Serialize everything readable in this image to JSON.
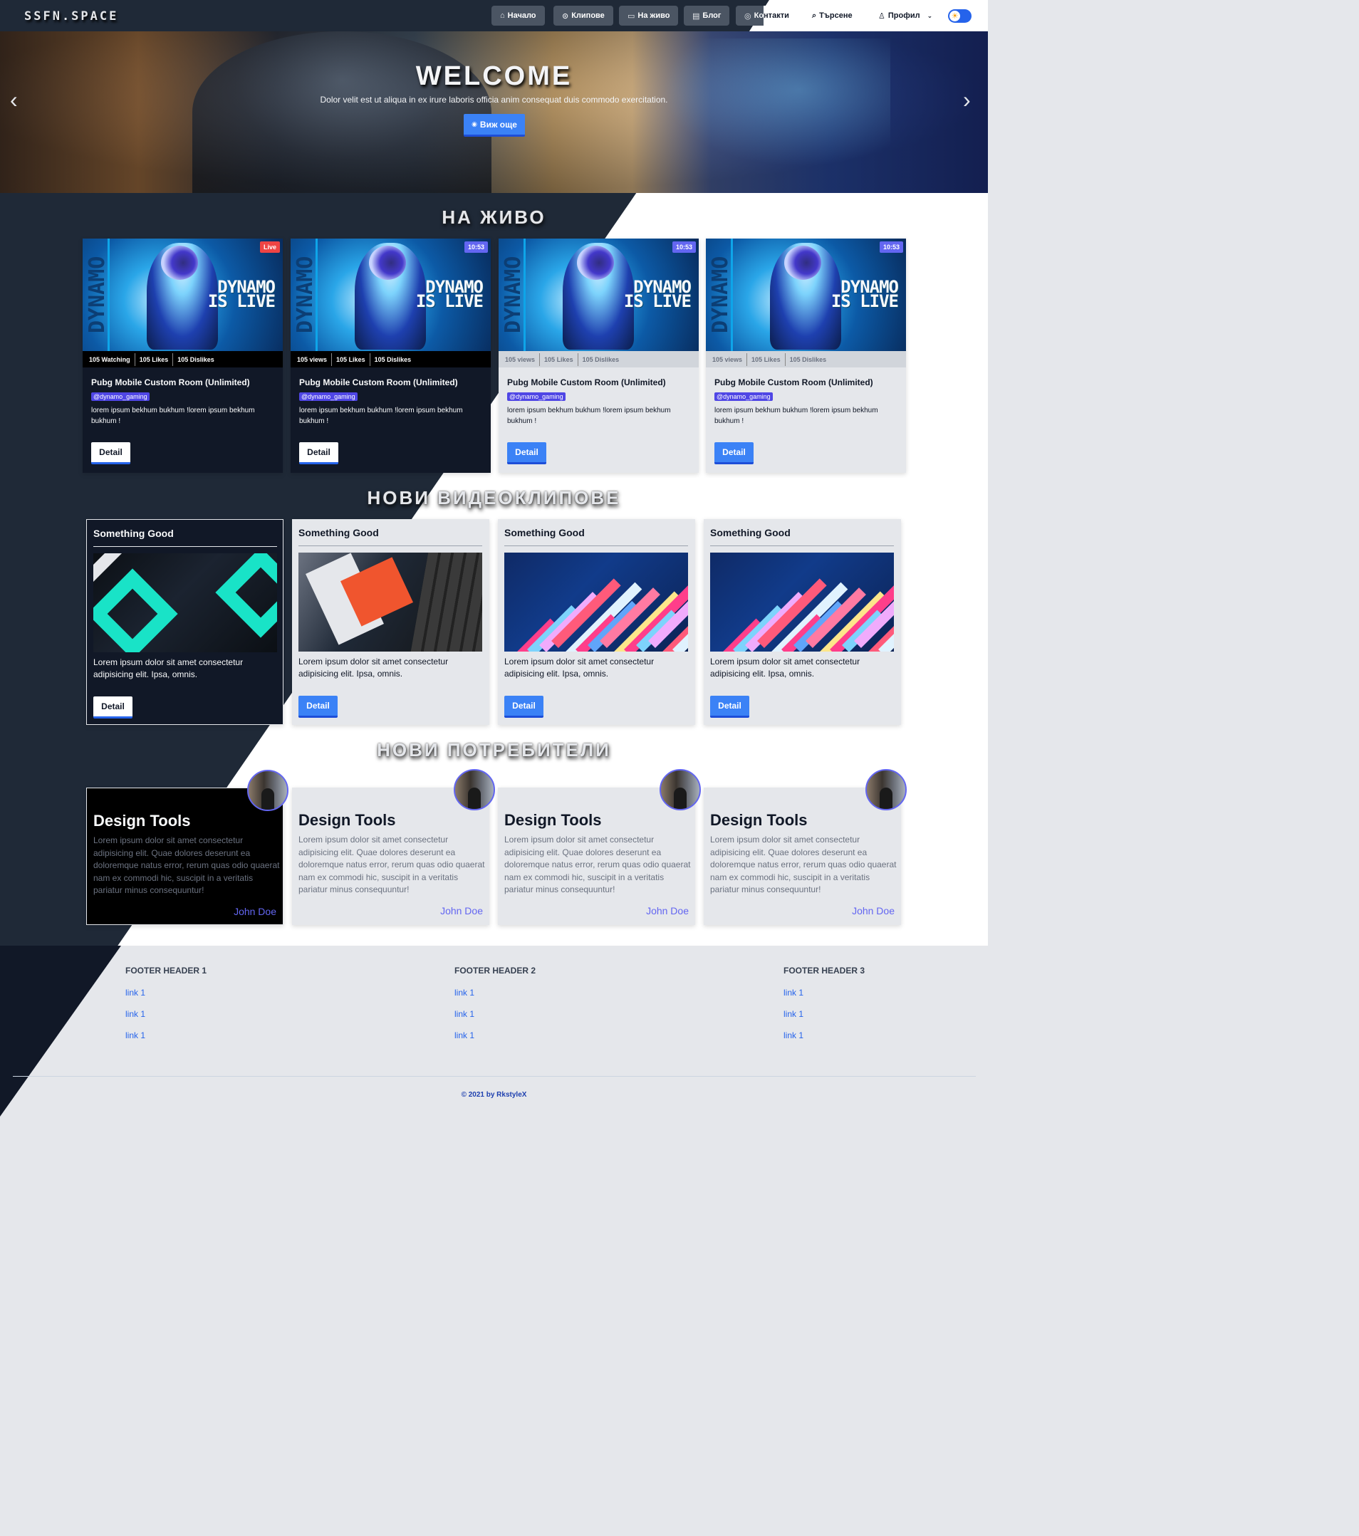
{
  "nav": {
    "logo": "SSFN.SPACE",
    "buttons": [
      {
        "label": "Начало",
        "icon": "home-icon"
      },
      {
        "label": "Клипове",
        "icon": "play-icon"
      },
      {
        "label": "На живо",
        "icon": "monitor-icon"
      },
      {
        "label": "Блог",
        "icon": "newspaper-icon"
      },
      {
        "label": "Контакти",
        "icon": "contact-icon"
      }
    ],
    "search_label": "Търсене",
    "profile_label": "Профил",
    "theme_toggle_icon": "sun-icon"
  },
  "hero": {
    "title": "WELCOME",
    "subtitle": "Dolor velit est ut aliqua in ex irure laboris officia anim consequat duis commodo exercitation.",
    "button_label": "Виж още",
    "prev_icon": "chevron-left-icon",
    "next_icon": "chevron-right-icon"
  },
  "live": {
    "heading": "НА ЖИВО",
    "cards": [
      {
        "badge": "Live",
        "badge_type": "live",
        "stats": [
          "105 Watching",
          "105 Likes",
          "105 Dislikes"
        ],
        "thumb_side": "DYNAMO",
        "thumb_text": "DYNAMO IS LIVE",
        "title": "Pubg Mobile Custom Room (Unlimited)",
        "tag": "@dynamo_gaming",
        "desc": "lorem ipsum bekhum bukhum !lorem ipsum bekhum bukhum !",
        "button": "Detail",
        "theme": "dark"
      },
      {
        "badge": "10:53",
        "badge_type": "time",
        "stats": [
          "105 views",
          "105 Likes",
          "105 Dislikes"
        ],
        "thumb_side": "DYNAMO",
        "thumb_text": "DYNAMO IS LIVE",
        "title": "Pubg Mobile Custom Room (Unlimited)",
        "tag": "@dynamo_gaming",
        "desc": "lorem ipsum bekhum bukhum !lorem ipsum bekhum bukhum !",
        "button": "Detail",
        "theme": "dark"
      },
      {
        "badge": "10:53",
        "badge_type": "time",
        "stats": [
          "105 views",
          "105 Likes",
          "105 Dislikes"
        ],
        "thumb_side": "DYNAMO",
        "thumb_text": "DYNAMO IS LIVE",
        "title": "Pubg Mobile Custom Room (Unlimited)",
        "tag": "@dynamo_gaming",
        "desc": "lorem ipsum bekhum bukhum !lorem ipsum bekhum bukhum !",
        "button": "Detail",
        "theme": "light"
      },
      {
        "badge": "10:53",
        "badge_type": "time",
        "stats": [
          "105 views",
          "105 Likes",
          "105 Dislikes"
        ],
        "thumb_side": "DYNAMO",
        "thumb_text": "DYNAMO IS LIVE",
        "title": "Pubg Mobile Custom Room (Unlimited)",
        "tag": "@dynamo_gaming",
        "desc": "lorem ipsum bekhum bukhum !lorem ipsum bekhum bukhum !",
        "button": "Detail",
        "theme": "light"
      }
    ]
  },
  "clips": {
    "heading": "НОВИ ВИДЕОКЛИПОВЕ",
    "cards": [
      {
        "title": "Something Good",
        "image": "teal",
        "desc": "Lorem ipsum dolor sit amet consectetur adipisicing elit. Ipsa, omnis.",
        "button": "Detail",
        "theme": "dark"
      },
      {
        "title": "Something Good",
        "image": "desk",
        "desc": "Lorem ipsum dolor sit amet consectetur adipisicing elit. Ipsa, omnis.",
        "button": "Detail",
        "theme": "light"
      },
      {
        "title": "Something Good",
        "image": "neon",
        "desc": "Lorem ipsum dolor sit amet consectetur adipisicing elit. Ipsa, omnis.",
        "button": "Detail",
        "theme": "light"
      },
      {
        "title": "Something Good",
        "image": "neon",
        "desc": "Lorem ipsum dolor sit amet consectetur adipisicing elit. Ipsa, omnis.",
        "button": "Detail",
        "theme": "light"
      }
    ]
  },
  "users": {
    "heading": "НОВИ ПОТРЕБИТЕЛИ",
    "cards": [
      {
        "title": "Design Tools",
        "desc": "Lorem ipsum dolor sit amet consectetur adipisicing elit. Quae dolores deserunt ea doloremque natus error, rerum quas odio quaerat nam ex commodi hic, suscipit in a veritatis pariatur minus consequuntur!",
        "author": "John Doe",
        "theme": "dark"
      },
      {
        "title": "Design Tools",
        "desc": "Lorem ipsum dolor sit amet consectetur adipisicing elit. Quae dolores deserunt ea doloremque natus error, rerum quas odio quaerat nam ex commodi hic, suscipit in a veritatis pariatur minus consequuntur!",
        "author": "John Doe",
        "theme": "light"
      },
      {
        "title": "Design Tools",
        "desc": "Lorem ipsum dolor sit amet consectetur adipisicing elit. Quae dolores deserunt ea doloremque natus error, rerum quas odio quaerat nam ex commodi hic, suscipit in a veritatis pariatur minus consequuntur!",
        "author": "John Doe",
        "theme": "light"
      },
      {
        "title": "Design Tools",
        "desc": "Lorem ipsum dolor sit amet consectetur adipisicing elit. Quae dolores deserunt ea doloremque natus error, rerum quas odio quaerat nam ex commodi hic, suscipit in a veritatis pariatur minus consequuntur!",
        "author": "John Doe",
        "theme": "light"
      }
    ]
  },
  "footer": {
    "columns": [
      {
        "header": "FOOTER HEADER 1",
        "links": [
          "link 1",
          "link 1",
          "link 1"
        ]
      },
      {
        "header": "FOOTER HEADER 2",
        "links": [
          "link 1",
          "link 1",
          "link 1"
        ]
      },
      {
        "header": "FOOTER HEADER 3",
        "links": [
          "link 1",
          "link 1",
          "link 1"
        ]
      }
    ],
    "copyright": "© 2021 by RkstyleX"
  },
  "colors": {
    "dark_bg": "#1f2937",
    "accent": "#3b82f6",
    "live_badge": "#ef4444",
    "time_badge": "#6366f1",
    "author": "#6366f1"
  }
}
